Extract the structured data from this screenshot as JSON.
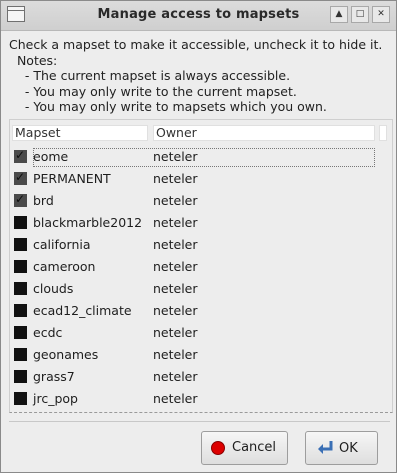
{
  "window": {
    "title": "Manage access to mapsets"
  },
  "description": {
    "line1": "Check a mapset to make it accessible, uncheck it to hide it.",
    "line2": "  Notes:",
    "line3": "    - The current mapset is always accessible.",
    "line4": "    - You may only write to the current mapset.",
    "line5": "    - You may only write to mapsets which you own."
  },
  "table": {
    "headers": {
      "mapset": "Mapset",
      "owner": "Owner"
    },
    "rows": [
      {
        "mapset": "eome",
        "owner": "neteler",
        "checked": true
      },
      {
        "mapset": "PERMANENT",
        "owner": "neteler",
        "checked": true
      },
      {
        "mapset": "brd",
        "owner": "neteler",
        "checked": true
      },
      {
        "mapset": "blackmarble2012",
        "owner": "neteler",
        "checked": false
      },
      {
        "mapset": "california",
        "owner": "neteler",
        "checked": false
      },
      {
        "mapset": "cameroon",
        "owner": "neteler",
        "checked": false
      },
      {
        "mapset": "clouds",
        "owner": "neteler",
        "checked": false
      },
      {
        "mapset": "ecad12_climate",
        "owner": "neteler",
        "checked": false
      },
      {
        "mapset": "ecdc",
        "owner": "neteler",
        "checked": false
      },
      {
        "mapset": "geonames",
        "owner": "neteler",
        "checked": false
      },
      {
        "mapset": "grass7",
        "owner": "neteler",
        "checked": false
      },
      {
        "mapset": "jrc_pop",
        "owner": "neteler",
        "checked": false
      }
    ]
  },
  "buttons": {
    "cancel": "Cancel",
    "ok": "OK"
  },
  "colors": {
    "stop_icon": "#dd0000",
    "ok_icon": "#3a6fb5"
  }
}
